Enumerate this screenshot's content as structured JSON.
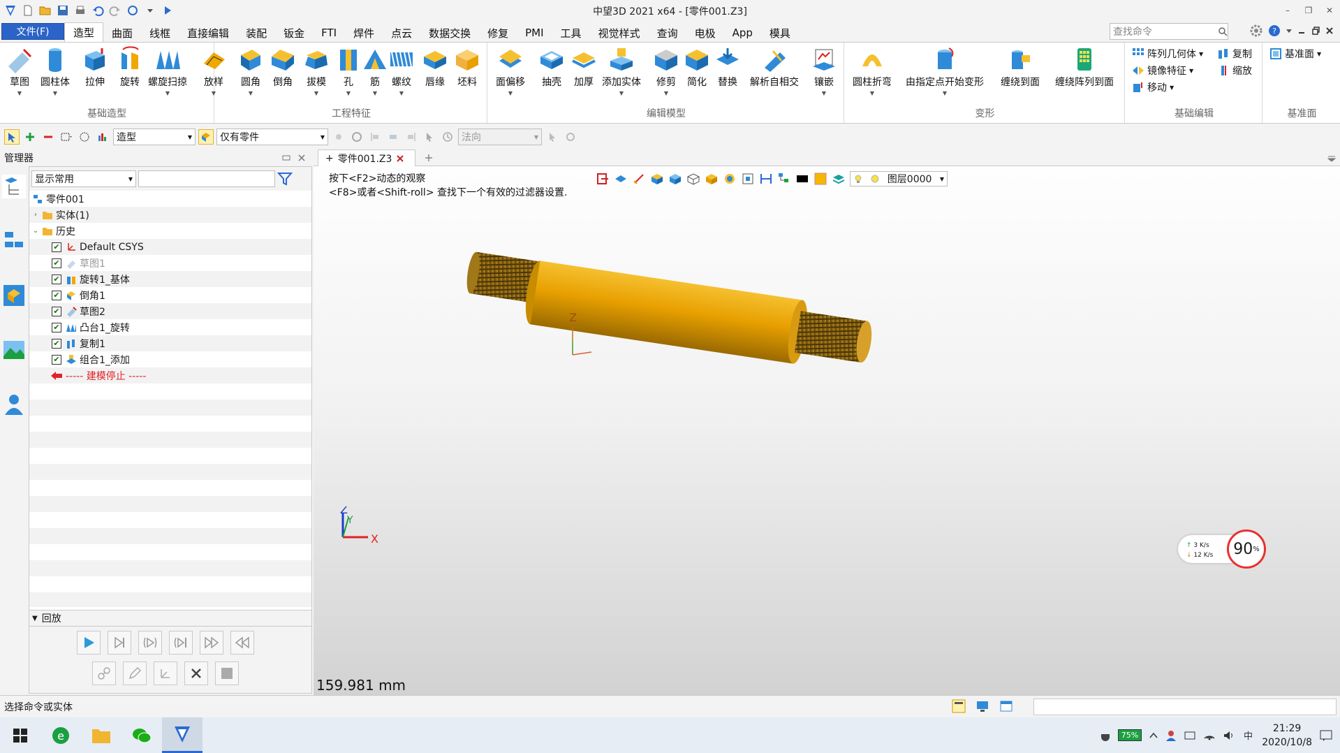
{
  "window": {
    "title": "中望3D 2021 x64 - [零件001.Z3]",
    "minimize": "–",
    "restore": "❐",
    "close": "✕"
  },
  "menu": {
    "file": "文件(F)",
    "tabs": [
      "造型",
      "曲面",
      "线框",
      "直接编辑",
      "装配",
      "钣金",
      "FTI",
      "焊件",
      "点云",
      "数据交换",
      "修复",
      "PMI",
      "工具",
      "视觉样式",
      "查询",
      "电极",
      "App",
      "模具"
    ],
    "active_tab": "造型",
    "search_placeholder": "查找命令"
  },
  "ribbon": {
    "groups": [
      {
        "label": "基础造型",
        "buttons": [
          "草图",
          "圆柱体",
          "拉伸",
          "旋转",
          "螺旋扫掠",
          "放样"
        ]
      },
      {
        "label": "工程特征",
        "buttons": [
          "圆角",
          "倒角",
          "拔模",
          "孔",
          "筋",
          "螺纹",
          "唇缘",
          "坯料"
        ]
      },
      {
        "label": "编辑模型",
        "buttons": [
          "面偏移",
          "抽壳",
          "加厚",
          "添加实体",
          "修剪",
          "简化",
          "替换",
          "解析自相交",
          "镶嵌"
        ]
      },
      {
        "label": "变形",
        "buttons": [
          "圆柱折弯",
          "由指定点开始变形",
          "缠绕到面",
          "缠绕阵列到面"
        ]
      },
      {
        "label": "基础编辑",
        "small": [
          "阵列几何体",
          "镜像特征",
          "移动",
          "复制",
          "缩放"
        ]
      },
      {
        "label": "基准面",
        "small": [
          "基准面"
        ]
      }
    ]
  },
  "toolbar2": {
    "mode": "造型",
    "filter": "仅有零件",
    "direction": "法向"
  },
  "manager": {
    "title": "管理器",
    "display_filter": "显示常用",
    "tree": {
      "root": "零件001",
      "solids": "实体(1)",
      "history": "历史",
      "items": [
        {
          "label": "Default CSYS",
          "checked": true,
          "faded": false,
          "icon": "csys-icon"
        },
        {
          "label": "草图1",
          "checked": true,
          "faded": true,
          "icon": "sketch-icon"
        },
        {
          "label": "旋转1_基体",
          "checked": true,
          "faded": false,
          "icon": "revolve-icon"
        },
        {
          "label": "倒角1",
          "checked": true,
          "faded": false,
          "icon": "chamfer-icon"
        },
        {
          "label": "草图2",
          "checked": true,
          "faded": false,
          "icon": "sketch-icon"
        },
        {
          "label": "凸台1_旋转",
          "checked": true,
          "faded": false,
          "icon": "helix-sweep-icon"
        },
        {
          "label": "复制1",
          "checked": true,
          "faded": false,
          "icon": "copy-icon"
        },
        {
          "label": "组合1_添加",
          "checked": true,
          "faded": false,
          "icon": "combine-icon"
        }
      ],
      "stop_marker": "----- 建模停止 -----"
    },
    "playback": "回放"
  },
  "document": {
    "tab": "零件001.Z3"
  },
  "viewport": {
    "hint_line1": "按下<F2>动态的观察",
    "hint_line2": "<F8>或者<Shift-roll> 查找下一个有效的过滤器设置.",
    "layer": "图层0000",
    "scale": "159.981 mm",
    "axis_z": "Z",
    "axis_y": "Y",
    "axis_x": "X",
    "net_up": "3",
    "net_down": "12",
    "net_unit": "K/s",
    "cpu": "90",
    "cpu_unit": "%",
    "part_color": "#e8a000"
  },
  "status": {
    "text": "选择命令或实体"
  },
  "taskbar": {
    "battery": "75%",
    "time": "21:29",
    "date": "2020/10/8"
  }
}
